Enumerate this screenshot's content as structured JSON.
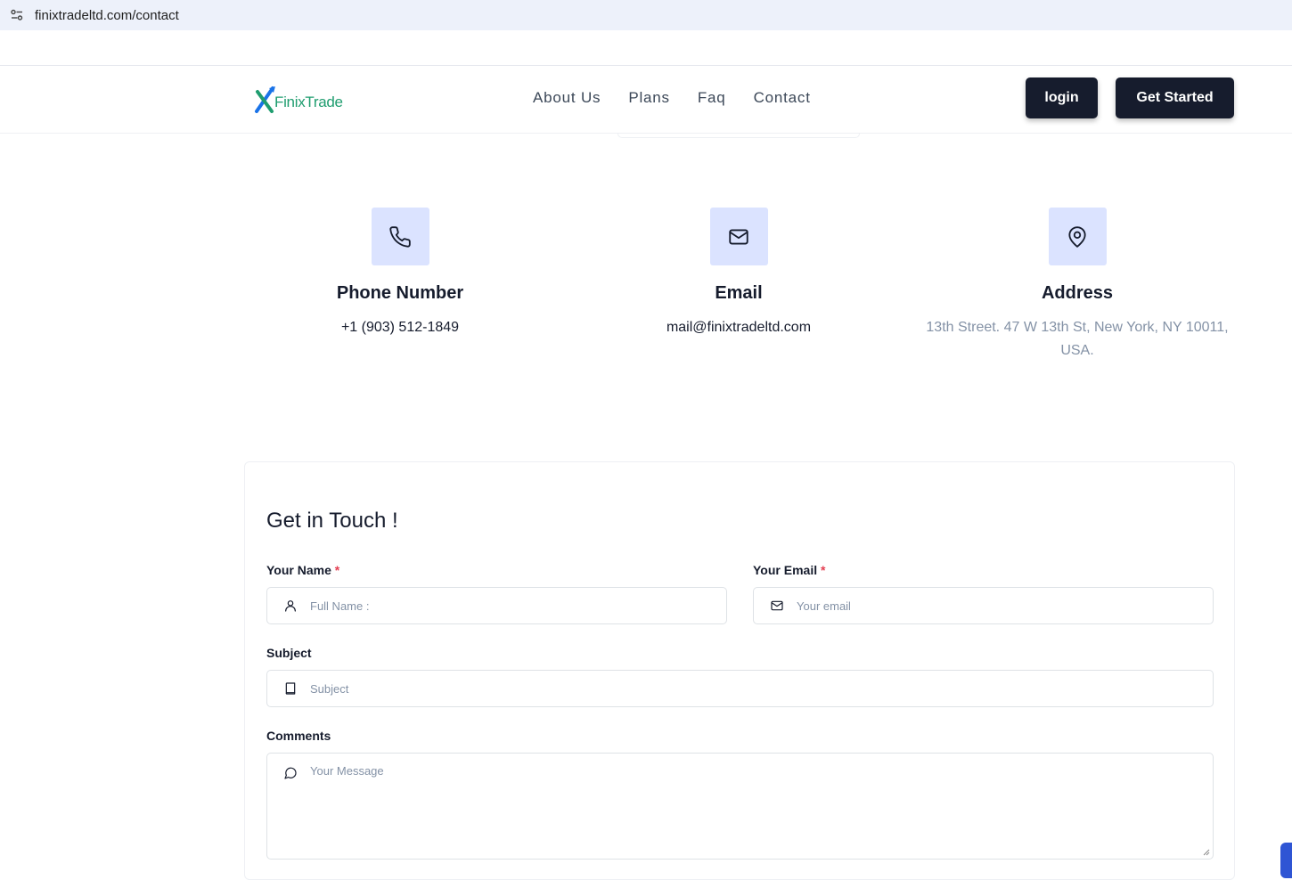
{
  "browser": {
    "url": "finixtradeltd.com/contact"
  },
  "brand": {
    "name": "FinixTrade",
    "accent_green": "#1f9d6f",
    "accent_blue": "#1a73e8"
  },
  "nav": {
    "links": [
      "About Us",
      "Plans",
      "Faq",
      "Contact"
    ],
    "login_label": "login",
    "get_started_label": "Get Started"
  },
  "contacts": [
    {
      "icon": "phone-icon",
      "title": "Phone Number",
      "value": "+1 (903) 512-1849"
    },
    {
      "icon": "mail-icon",
      "title": "Email",
      "value": "mail@finixtradeltd.com"
    },
    {
      "icon": "map-pin-icon",
      "title": "Address",
      "value": "13th Street. 47 W 13th St, New York, NY 10011, USA."
    }
  ],
  "form": {
    "title": "Get in Touch !",
    "name": {
      "label": "Your Name",
      "required": "*",
      "placeholder": "Full Name :",
      "value": ""
    },
    "email": {
      "label": "Your Email",
      "required": "*",
      "placeholder": "Your email",
      "value": ""
    },
    "subject": {
      "label": "Subject",
      "placeholder": "Subject",
      "value": ""
    },
    "comments": {
      "label": "Comments",
      "placeholder": "Your Message",
      "value": ""
    }
  },
  "colors": {
    "dark": "#161c2d",
    "icon_bg": "#dbe3ff",
    "muted": "#8492a6",
    "required": "#e43f52"
  }
}
